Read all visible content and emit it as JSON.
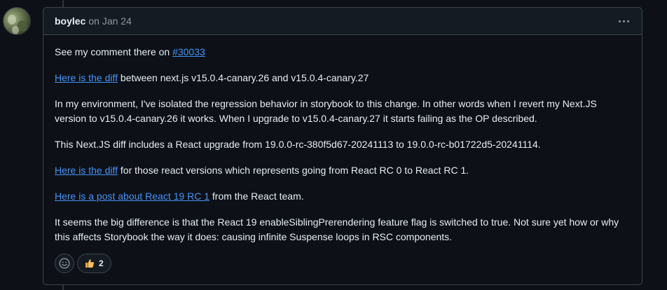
{
  "comment": {
    "author": "boylec",
    "timestamp": "on Jan 24",
    "menu_icon": "kebab-horizontal-icon"
  },
  "body": {
    "p1_text": "See my comment there on ",
    "p1_link": "#30033",
    "p2_link": "Here is the diff",
    "p2_text": " between next.js v15.0.4-canary.26 and v15.0.4-canary.27",
    "p3_text": "In my environment, I've isolated the regression behavior in storybook to this change. In other words when I revert my Next.JS version to v15.0.4-canary.26 it works. When I upgrade to v15.0.4-canary.27 it starts failing as the OP described.",
    "p4_text": "This Next.JS diff includes a React upgrade from 19.0.0-rc-380f5d67-20241113 to 19.0.0-rc-b01722d5-20241114.",
    "p5_link": "Here is the diff",
    "p5_text": " for those react versions which represents going from React RC 0 to React RC 1.",
    "p6_link": "Here is a post about React 19 RC 1",
    "p6_text": " from the React team.",
    "p7_text": "It seems the big difference is that the React 19 enableSiblingPrerendering feature flag is switched to true. Not sure yet how or why this affects Storybook the way it does: causing infinite Suspense loops in RSC components."
  },
  "reactions": {
    "add_icon": "smiley-icon",
    "thumbs_up_icon": "thumbs-up-icon",
    "thumbs_up_count": "2"
  },
  "colors": {
    "background": "#0d1117",
    "header_bg": "#151b23",
    "border": "#3d444d",
    "link": "#4493f8",
    "muted": "#9198a1",
    "text": "#e6edf3"
  }
}
